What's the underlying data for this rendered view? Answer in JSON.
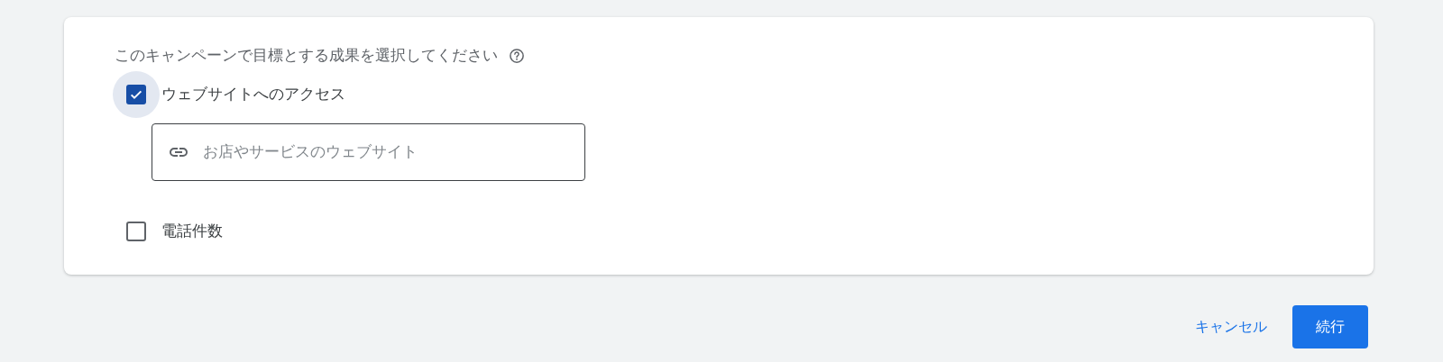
{
  "card": {
    "question": "このキャンペーンで目標とする成果を選択してください",
    "options": [
      {
        "label": "ウェブサイトへのアクセス",
        "checked": true,
        "focused": true,
        "url_field": {
          "placeholder": "お店やサービスのウェブサイト"
        }
      },
      {
        "label": "電話件数",
        "checked": false,
        "focused": false
      }
    ]
  },
  "buttons": {
    "cancel": "キャンセル",
    "continue": "続行"
  }
}
